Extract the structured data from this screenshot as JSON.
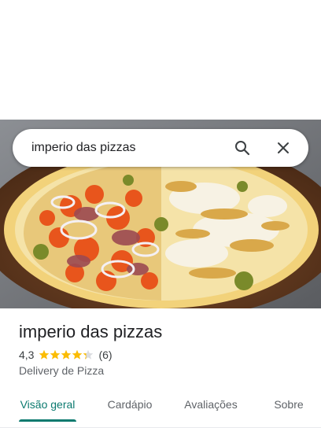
{
  "search": {
    "query": "imperio das pizzas"
  },
  "place": {
    "name": "imperio das pizzas",
    "rating": "4,3",
    "stars": 4.3,
    "review_count": "(6)",
    "category": "Delivery de Pizza"
  },
  "tabs": [
    {
      "label": "Visão geral",
      "active": true
    },
    {
      "label": "Cardápio",
      "active": false
    },
    {
      "label": "Avaliações",
      "active": false
    },
    {
      "label": "Sobre",
      "active": false
    }
  ],
  "colors": {
    "accent": "#0b7a6f",
    "star": "#fbbc04"
  },
  "icons": {
    "search": "search-icon",
    "close": "close-icon"
  }
}
